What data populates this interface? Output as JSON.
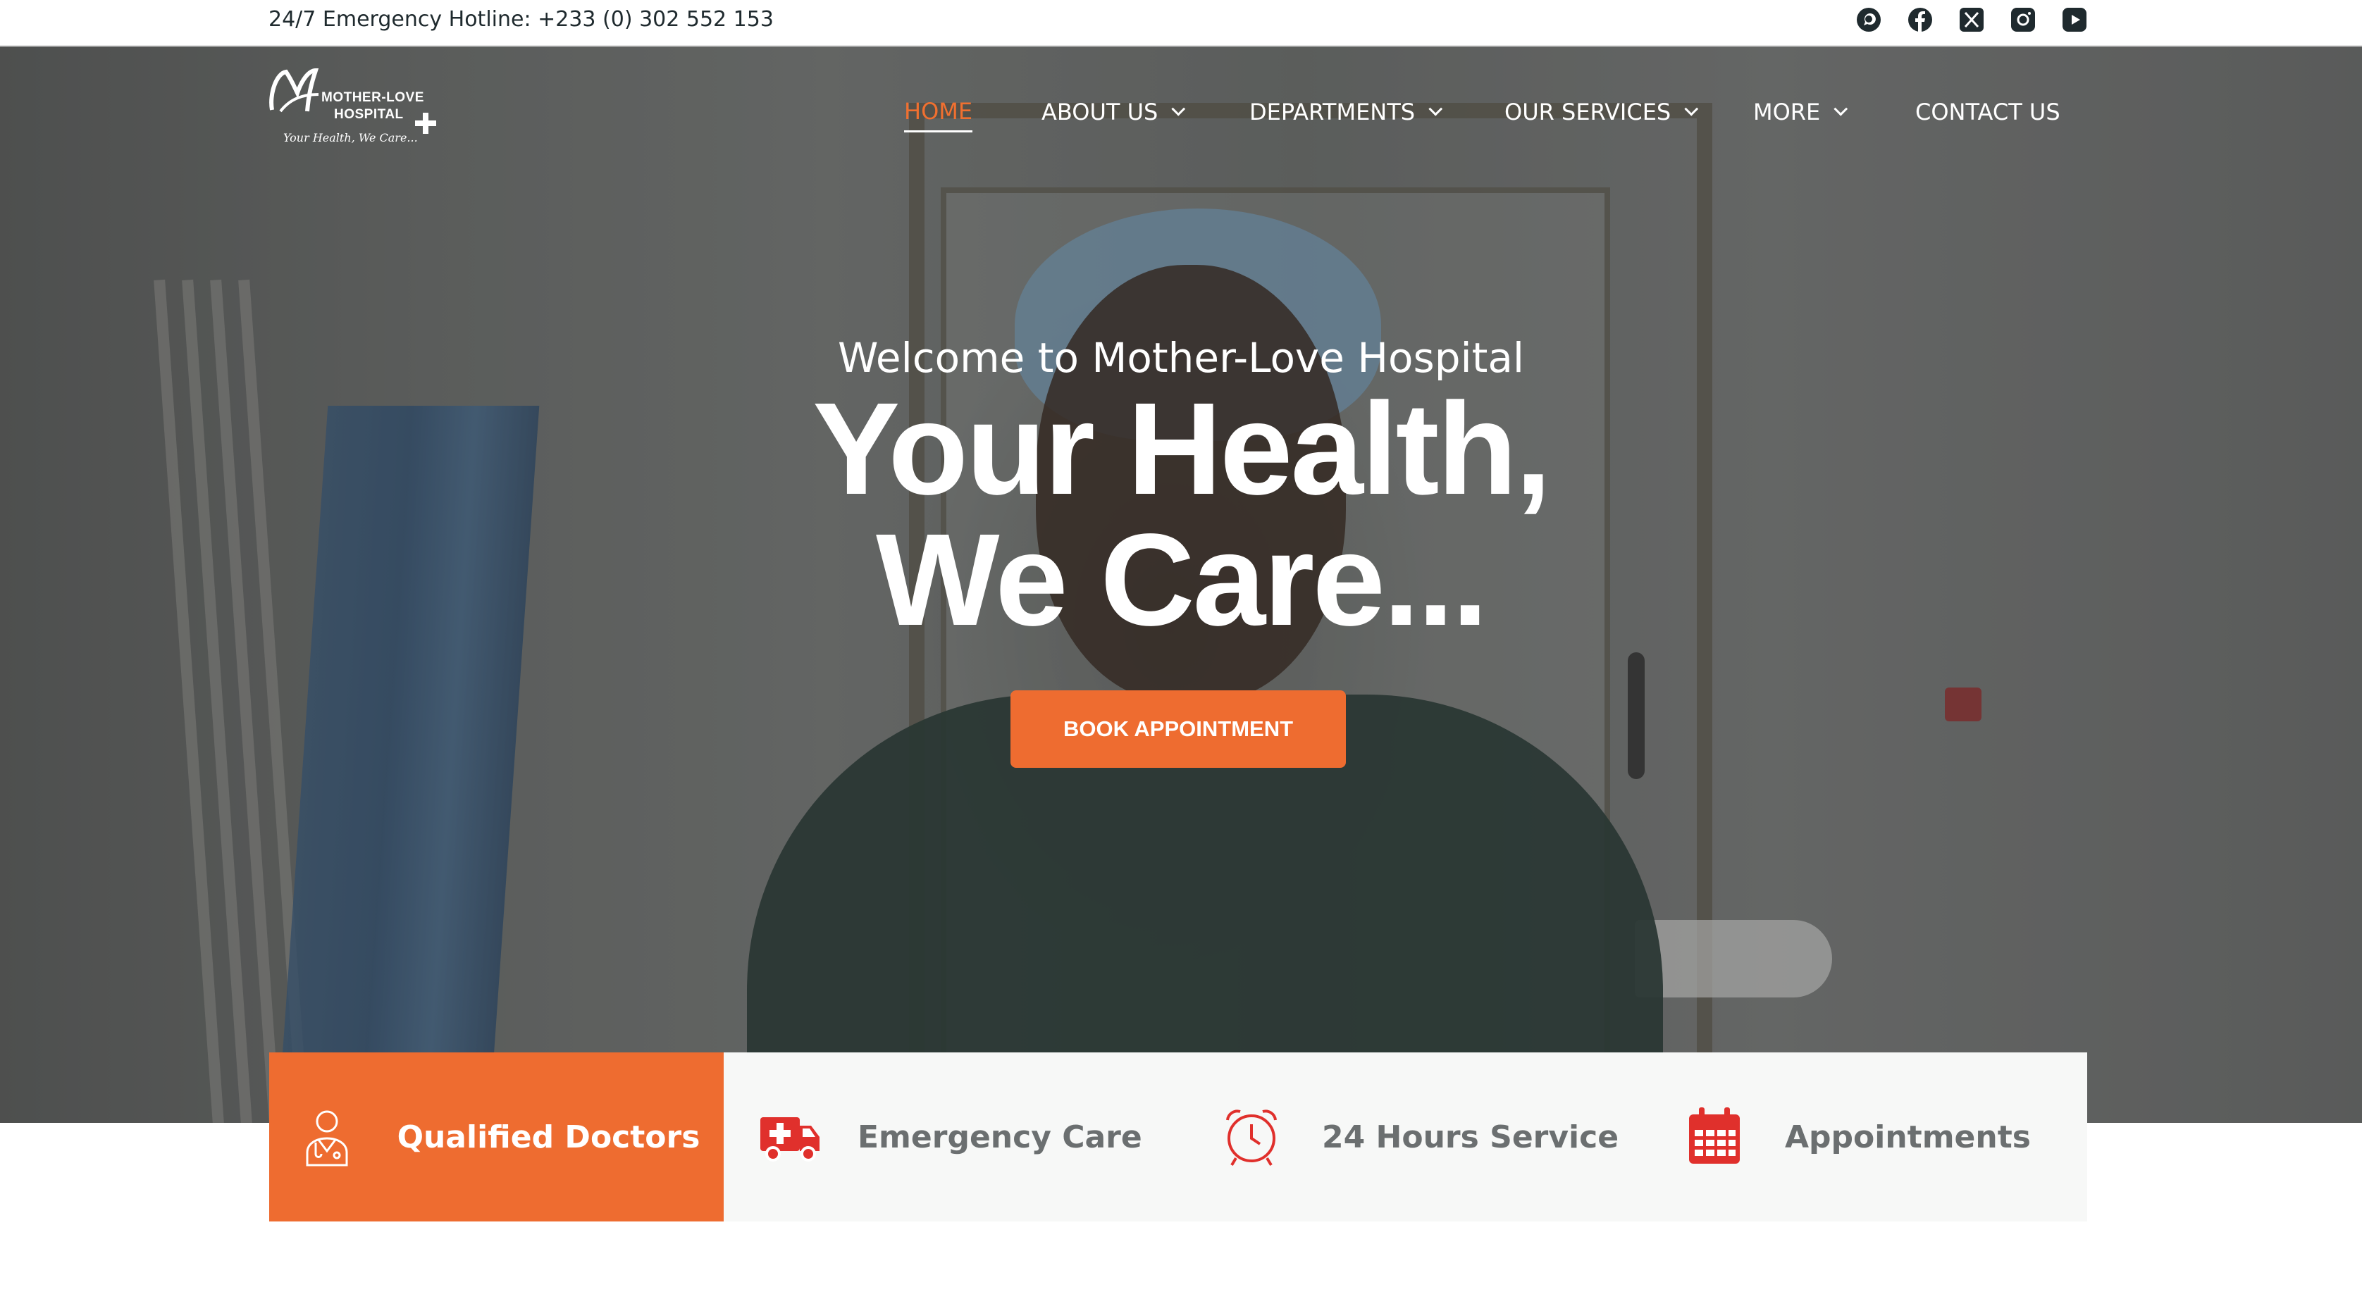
{
  "topbar": {
    "hotline": "24/7 Emergency Hotline: +233 (0) 302 552 153",
    "socials": [
      "whatsapp-icon",
      "facebook-icon",
      "x-icon",
      "instagram-icon",
      "youtube-icon"
    ]
  },
  "logo": {
    "line1": "MOTHER-LOVE",
    "line2": "HOSPITAL",
    "tagline": "Your Health, We Care..."
  },
  "nav": {
    "items": [
      {
        "label": "HOME",
        "active": true,
        "dropdown": false
      },
      {
        "label": "ABOUT US",
        "active": false,
        "dropdown": true
      },
      {
        "label": "DEPARTMENTS",
        "active": false,
        "dropdown": true
      },
      {
        "label": "OUR SERVICES",
        "active": false,
        "dropdown": true
      },
      {
        "label": "MORE",
        "active": false,
        "dropdown": true
      },
      {
        "label": "CONTACT US",
        "active": false,
        "dropdown": false
      }
    ]
  },
  "hero": {
    "welcome": "Welcome to Mother-Love Hospital",
    "title_line1": "Your Health,",
    "title_line2": "We Care...",
    "cta_label": "BOOK APPOINTMENT"
  },
  "features": [
    {
      "label": "Qualified Doctors",
      "icon": "doctor-icon"
    },
    {
      "label": "Emergency Care",
      "icon": "ambulance-icon"
    },
    {
      "label": "24 Hours Service",
      "icon": "alarm-clock-icon"
    },
    {
      "label": "Appointments",
      "icon": "calendar-icon"
    }
  ],
  "colors": {
    "accent": "#ee6c30",
    "icon_red": "#e0302c",
    "text_dark": "#1f2a2e",
    "feature_text": "#6b6f70",
    "feature_bg": "#f7f8f7"
  }
}
